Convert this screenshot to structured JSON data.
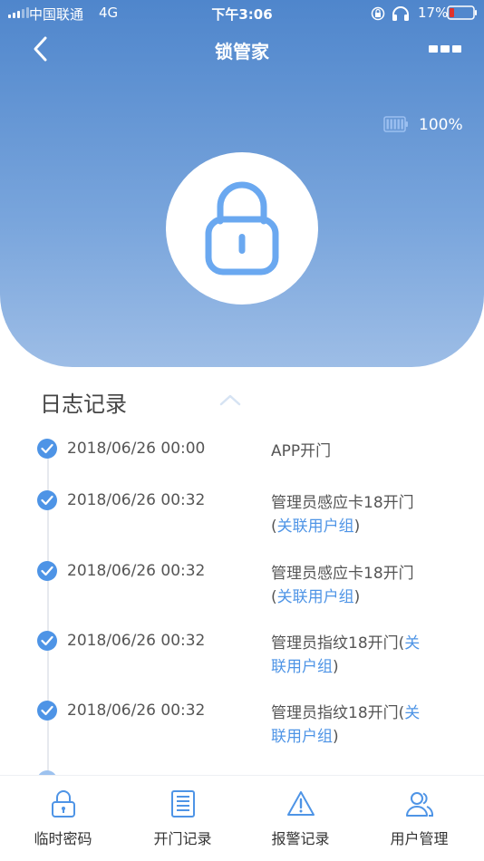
{
  "status_bar": {
    "carrier": "中国联通",
    "network": "4G",
    "time": "下午3:06",
    "battery_percent": "17%"
  },
  "nav": {
    "title": "锁管家",
    "back_icon": "chevron-left-icon",
    "more_icon": "more-icon"
  },
  "lock": {
    "battery_label": "100%",
    "battery_level": 1.0,
    "icon": "lock-icon"
  },
  "log": {
    "title": "日志记录",
    "collapse_icon": "chevron-up-icon",
    "items": [
      {
        "time": "2018/06/26 00:00",
        "text": "APP开门",
        "prefix": "",
        "link": "",
        "suffix": ""
      },
      {
        "time": "2018/06/26 00:32",
        "text": "管理员感应卡18开门",
        "prefix": "(",
        "link": "关联用户组",
        "suffix": ")"
      },
      {
        "time": "2018/06/26 00:32",
        "text": "管理员感应卡18开门",
        "prefix": "(",
        "link": "关联用户组",
        "suffix": ")"
      },
      {
        "time": "2018/06/26 00:32",
        "text": "管理员指纹18开门",
        "prefix": "(",
        "link": "关联用户组",
        "suffix": ")"
      },
      {
        "time": "2018/06/26 00:32",
        "text": "管理员指纹18开门",
        "prefix": "(",
        "link": "关联用户组",
        "suffix": ")"
      }
    ]
  },
  "tabs": [
    {
      "label": "临时密码",
      "icon": "temp-password-icon"
    },
    {
      "label": "开门记录",
      "icon": "door-record-icon"
    },
    {
      "label": "报警记录",
      "icon": "alarm-icon"
    },
    {
      "label": "用户管理",
      "icon": "users-icon"
    }
  ],
  "colors": {
    "accent": "#4e94e6",
    "header_top": "#4f86cc",
    "header_bottom": "#9dbde6"
  }
}
